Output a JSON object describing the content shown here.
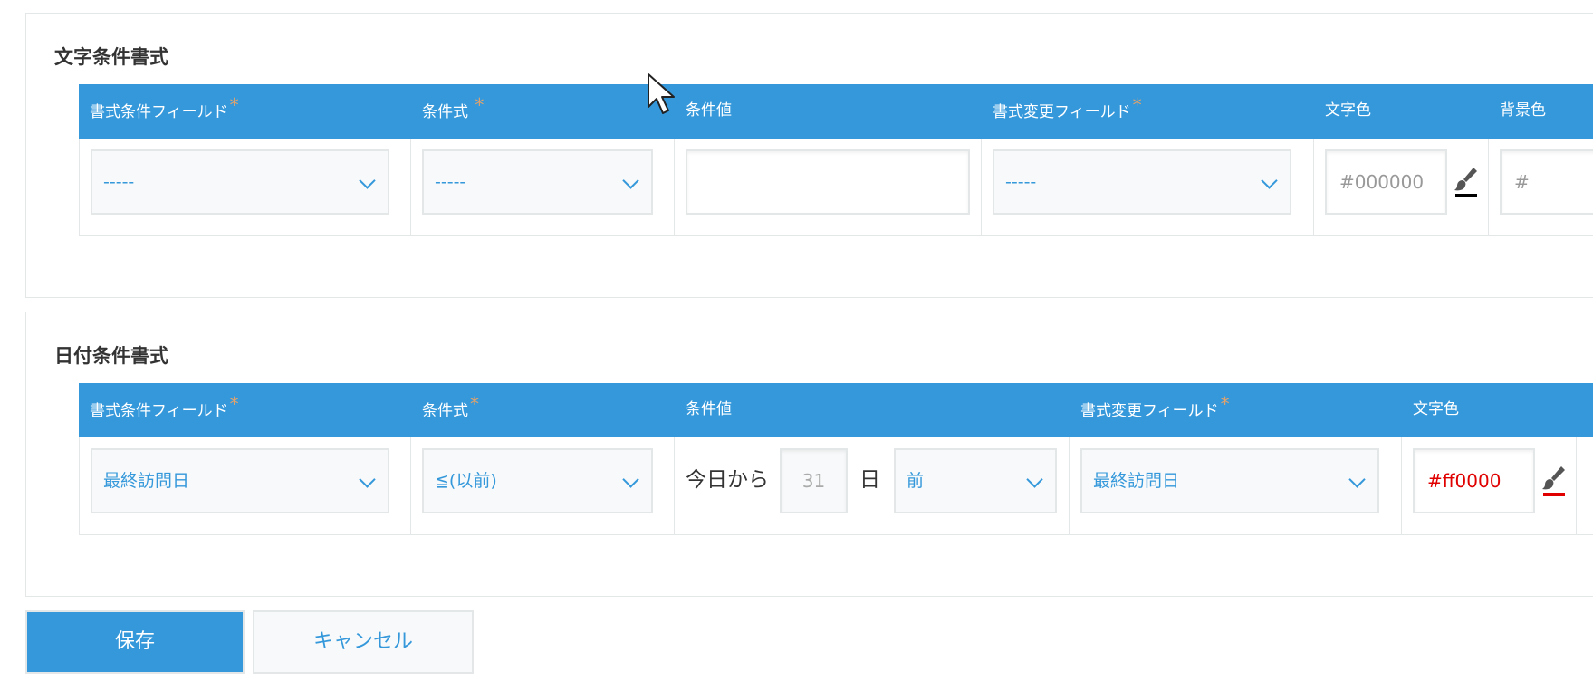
{
  "text_format": {
    "title": "文字条件書式",
    "headers": {
      "format_field": "書式条件フィールド",
      "condition": "条件式",
      "condition_value": "条件値",
      "change_field": "書式変更フィールド",
      "text_color": "文字色",
      "bg_color": "背景色"
    },
    "required_mark": "*",
    "row": {
      "format_field_value": "-----",
      "condition_value": "-----",
      "condition_input": "",
      "change_field_value": "-----",
      "text_color_value": "#000000",
      "bg_color_value": "#"
    }
  },
  "date_format": {
    "title": "日付条件書式",
    "headers": {
      "format_field": "書式条件フィールド",
      "condition": "条件式",
      "condition_value": "条件値",
      "change_field": "書式変更フィールド",
      "text_color": "文字色"
    },
    "required_mark": "*",
    "row": {
      "format_field_value": "最終訪問日",
      "condition_value": "≦(以前)",
      "prefix_label": "今日から",
      "days_value": "31",
      "days_unit": "日",
      "direction_value": "前",
      "change_field_value": "最終訪問日",
      "text_color_value": "#ff0000"
    }
  },
  "buttons": {
    "save": "保存",
    "cancel": "キャンセル"
  },
  "colors": {
    "accent": "#3498db",
    "required": "#e3a36b",
    "black_swatch": "#000000",
    "red_swatch": "#e00000"
  }
}
